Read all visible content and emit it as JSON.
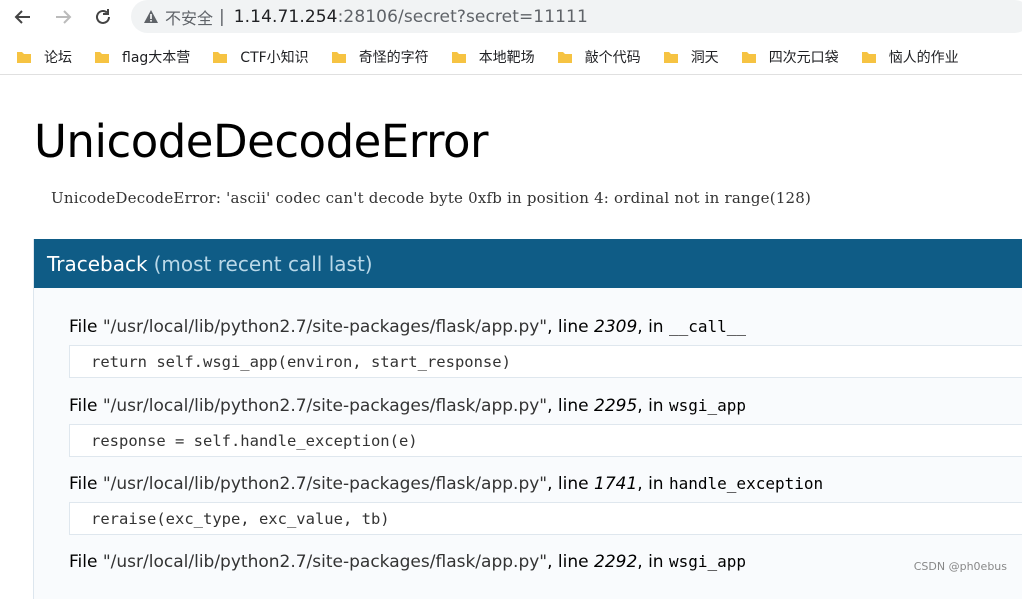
{
  "browser": {
    "security_label": "不安全",
    "url_host": "1.14.71.254",
    "url_rest": ":28106/secret?secret=11111",
    "bookmarks": [
      {
        "label": "论坛"
      },
      {
        "label": "flag大本营"
      },
      {
        "label": "CTF小知识"
      },
      {
        "label": "奇怪的字符"
      },
      {
        "label": "本地靶场"
      },
      {
        "label": "敲个代码"
      },
      {
        "label": "洞天"
      },
      {
        "label": "四次元口袋"
      },
      {
        "label": "恼人的作业"
      }
    ]
  },
  "error": {
    "title": "UnicodeDecodeError",
    "message": "UnicodeDecodeError: 'ascii' codec can't decode byte 0xfb in position 4: ordinal not in range(128)"
  },
  "traceback": {
    "header": "Traceback",
    "subheader": "(most recent call last)",
    "frames": [
      {
        "prefix": "File ",
        "file": "\"/usr/local/lib/python2.7/site-packages/flask/app.py\"",
        "mid": ", line ",
        "line": "2309",
        "in": ", in ",
        "func": "__call__",
        "code": "return self.wsgi_app(environ, start_response)"
      },
      {
        "prefix": "File ",
        "file": "\"/usr/local/lib/python2.7/site-packages/flask/app.py\"",
        "mid": ", line ",
        "line": "2295",
        "in": ", in ",
        "func": "wsgi_app",
        "code": "response = self.handle_exception(e)"
      },
      {
        "prefix": "File ",
        "file": "\"/usr/local/lib/python2.7/site-packages/flask/app.py\"",
        "mid": ", line ",
        "line": "1741",
        "in": ", in ",
        "func": "handle_exception",
        "code": "reraise(exc_type, exc_value, tb)"
      },
      {
        "prefix": "File ",
        "file": "\"/usr/local/lib/python2.7/site-packages/flask/app.py\"",
        "mid": ", line ",
        "line": "2292",
        "in": ", in ",
        "func": "wsgi_app",
        "code": ""
      }
    ]
  },
  "watermark": "CSDN @ph0ebus",
  "colors": {
    "header_bg": "#0f5c86",
    "folder": "#f6c342"
  }
}
